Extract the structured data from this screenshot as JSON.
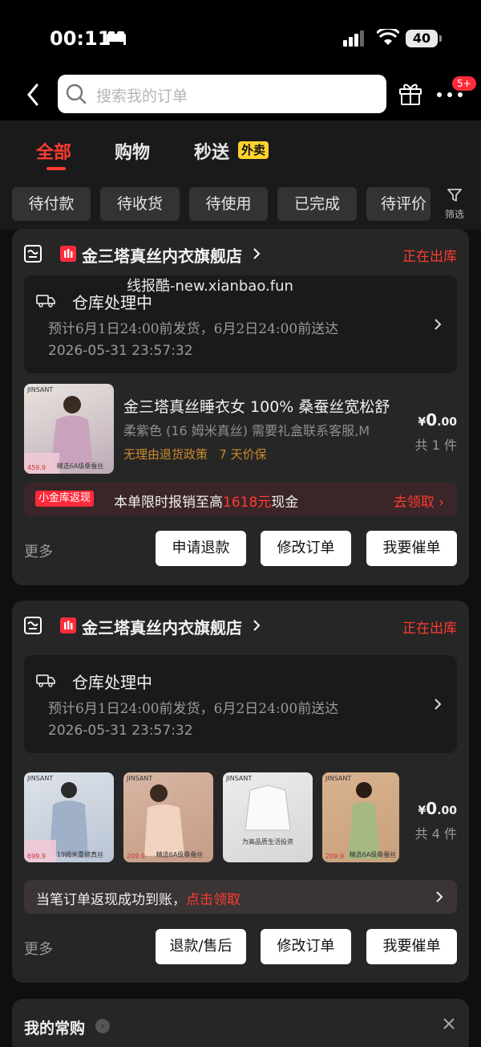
{
  "status_bar": {
    "time": "00:11",
    "battery": "40"
  },
  "header": {
    "search_placeholder": "搜索我的订单",
    "badge": "5+"
  },
  "tabs": [
    {
      "label": "全部"
    },
    {
      "label": "购物"
    },
    {
      "label": "秒送"
    }
  ],
  "waimai_tag": "外卖",
  "chips": [
    "待付款",
    "待收货",
    "待使用",
    "已完成",
    "待评价"
  ],
  "filter_label": "筛选",
  "watermark": "线报酷-new.xianbao.fun",
  "orders": [
    {
      "shop": "金三塔真丝内衣旗舰店",
      "status": "正在出库",
      "logistics": {
        "title": "仓库处理中",
        "line1": "预计6月1日24:00前发货，6月2日24:00前送达",
        "line2": "2026-05-31 23:57:32"
      },
      "product": {
        "name": "金三塔真丝睡衣女 100% 桑蚕丝宽松舒",
        "spec": "柔紫色 (16 姆米真丝) 需要礼盒联系客服,M",
        "tags": "无理由退货政策   7 天价保",
        "price_symbol": "¥",
        "price_int": "0",
        "price_dec": ".00",
        "count": "共 1 件",
        "thumb_brand": "JINSANT",
        "thumb_price": "459.9",
        "thumb_cap": "精选6A级桑蚕丝"
      },
      "promo": {
        "tag": "小金库返现",
        "text_before": "本单限时报销至高",
        "amount": "1618元",
        "text_after": "现金",
        "action": "去领取"
      },
      "more": "更多",
      "buttons": [
        "申请退款",
        "修改订单",
        "我要催单"
      ]
    },
    {
      "shop": "金三塔真丝内衣旗舰店",
      "status": "正在出库",
      "logistics": {
        "title": "仓库处理中",
        "line1": "预计6月1日24:00前发货，6月2日24:00前送达",
        "line2": "2026-05-31 23:57:32"
      },
      "thumbs": [
        {
          "brand": "JINSANT",
          "price": "699.9",
          "cap": "19姆米重磅真丝"
        },
        {
          "brand": "JINSANT",
          "price": "209.9",
          "cap": "精选6A级桑蚕丝"
        },
        {
          "brand": "JINSANT",
          "price": "",
          "cap": "为高品质生活投资"
        },
        {
          "brand": "JINSANT",
          "price": "209.9",
          "cap": "精选6A级桑蚕丝"
        }
      ],
      "price_symbol": "¥",
      "price_int": "0",
      "price_dec": ".00",
      "count": "共 4 件",
      "cashback": {
        "text": "当笔订单返现成功到账，",
        "action": "点击领取"
      },
      "more": "更多",
      "buttons": [
        "退款/售后",
        "修改订单",
        "我要催单"
      ]
    }
  ],
  "regular": {
    "title": "我的常购"
  },
  "colors": {
    "accent": "#ff3b30",
    "background": "#0f0f0f",
    "card": "#262626"
  }
}
